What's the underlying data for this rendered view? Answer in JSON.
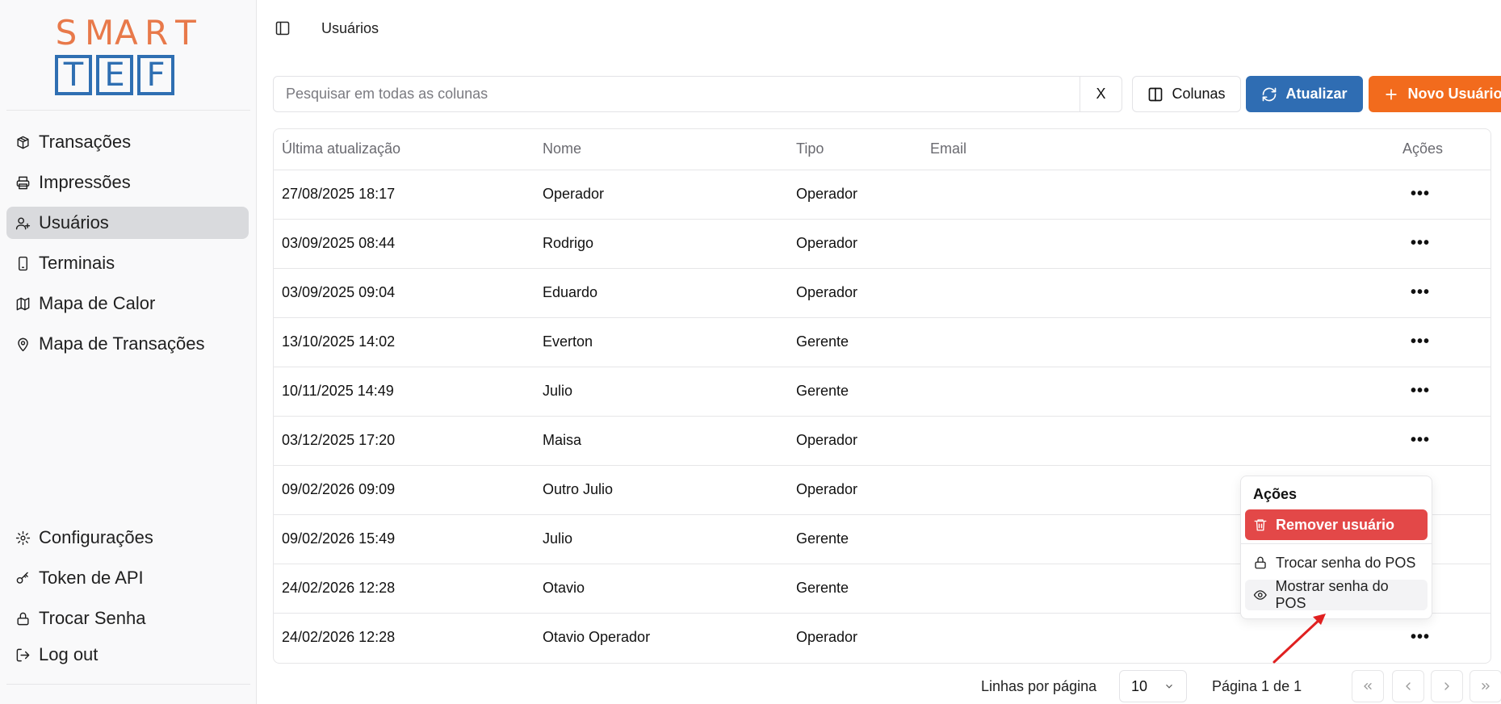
{
  "logo": {
    "top_letters": [
      "S",
      "M",
      "A",
      "R",
      "T"
    ],
    "box_letters": [
      "T",
      "E",
      "F"
    ]
  },
  "sidebar": {
    "items": [
      {
        "label": "Transações",
        "icon": "box-icon"
      },
      {
        "label": "Impressões",
        "icon": "printer-icon"
      },
      {
        "label": "Usuários",
        "icon": "user-plus-icon",
        "active": true
      },
      {
        "label": "Terminais",
        "icon": "tablet-icon"
      },
      {
        "label": "Mapa de Calor",
        "icon": "map-icon"
      },
      {
        "label": "Mapa de Transações",
        "icon": "map-pin-icon"
      }
    ],
    "bottom_items": [
      {
        "label": "Configurações",
        "icon": "gear-icon"
      },
      {
        "label": "Token de API",
        "icon": "key-icon"
      },
      {
        "label": "Trocar Senha",
        "icon": "lock-icon"
      },
      {
        "label": "Log out",
        "icon": "logout-icon"
      }
    ]
  },
  "header": {
    "breadcrumb": "Usuários"
  },
  "toolbar": {
    "search_placeholder": "Pesquisar em todas as colunas",
    "clear_label": "X",
    "columns_label": "Colunas",
    "refresh_label": "Atualizar",
    "new_user_label": "Novo Usuário"
  },
  "table": {
    "headers": [
      "Última atualização",
      "Nome",
      "Tipo",
      "Email",
      "Ações"
    ],
    "rows": [
      {
        "date": "27/08/2025 18:17",
        "name": "Operador",
        "tipo": "Operador",
        "email": ""
      },
      {
        "date": "03/09/2025 08:44",
        "name": "Rodrigo",
        "tipo": "Operador",
        "email": ""
      },
      {
        "date": "03/09/2025 09:04",
        "name": "Eduardo",
        "tipo": "Operador",
        "email": ""
      },
      {
        "date": "13/10/2025 14:02",
        "name": "Everton",
        "tipo": "Gerente",
        "email": ""
      },
      {
        "date": "10/11/2025 14:49",
        "name": "Julio",
        "tipo": "Gerente",
        "email": ""
      },
      {
        "date": "03/12/2025 17:20",
        "name": "Maisa",
        "tipo": "Operador",
        "email": ""
      },
      {
        "date": "09/02/2026 09:09",
        "name": "Outro Julio",
        "tipo": "Operador",
        "email": ""
      },
      {
        "date": "09/02/2026 15:49",
        "name": "Julio",
        "tipo": "Gerente",
        "email": ""
      },
      {
        "date": "24/02/2026 12:28",
        "name": "Otavio",
        "tipo": "Gerente",
        "email": ""
      },
      {
        "date": "24/02/2026 12:28",
        "name": "Otavio Operador",
        "tipo": "Operador",
        "email": ""
      }
    ],
    "actions_glyph": "•••",
    "visible_action_rows": [
      0,
      1,
      2,
      3,
      4,
      5,
      9
    ]
  },
  "actions_menu": {
    "title": "Ações",
    "remove": "Remover usuário",
    "change_pos_password": "Trocar senha do POS",
    "show_pos_password": "Mostrar senha do POS"
  },
  "pagination": {
    "rows_label": "Linhas por página",
    "rows_value": "10",
    "page_info": "Página 1 de 1"
  },
  "colors": {
    "primary": "#2f6db3",
    "accent": "#f26b1d",
    "danger": "#e34848",
    "logo_orange": "#e8794a",
    "logo_blue": "#2f6fb2"
  }
}
